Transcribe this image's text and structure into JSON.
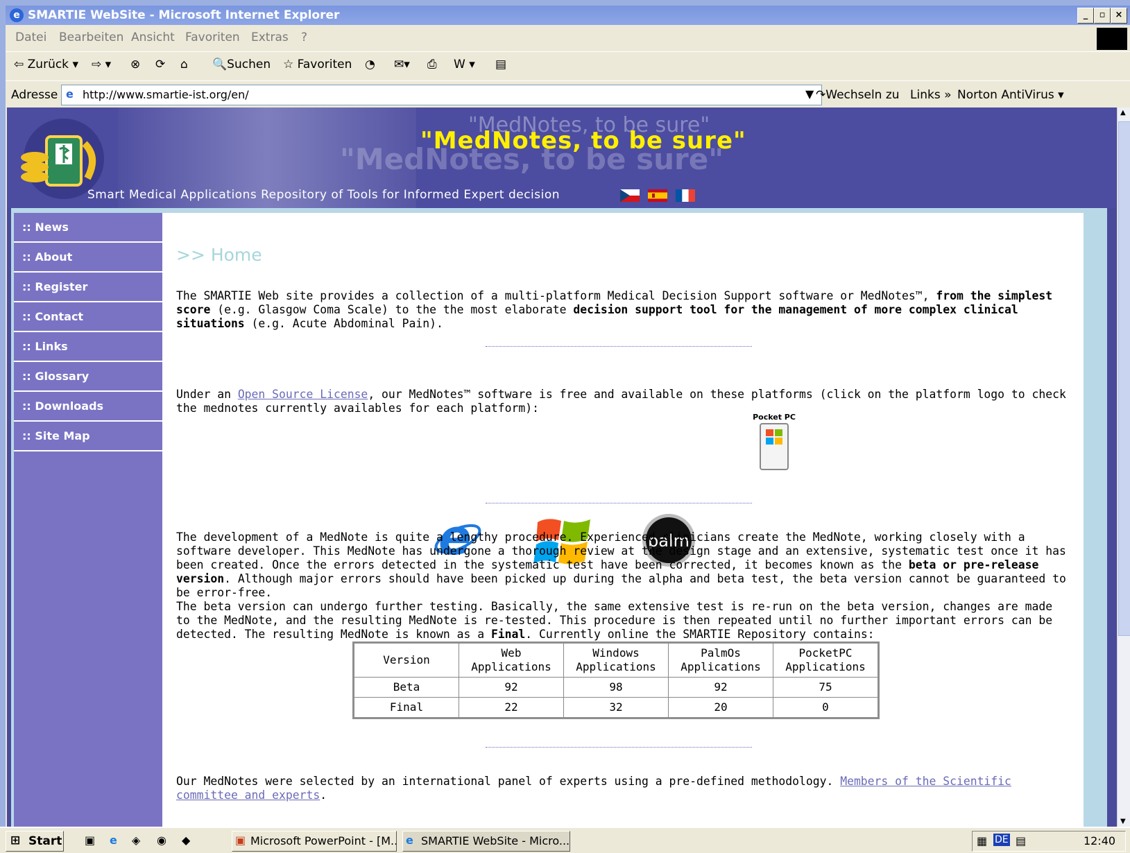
{
  "window": {
    "title": "SMARTIE WebSite - Microsoft Internet Explorer"
  },
  "menu": [
    "Datei",
    "Bearbeiten",
    "Ansicht",
    "Favoriten",
    "Extras",
    "?"
  ],
  "toolbar": {
    "back": "Zurück",
    "search": "Suchen",
    "favorites": "Favoriten"
  },
  "addressbar": {
    "label": "Adresse",
    "url": "http://www.smartie-ist.org/en/",
    "go": "Wechseln zu",
    "links": "Links",
    "norton": "Norton AntiVirus"
  },
  "banner": {
    "slogan": "\"MedNotes, to be sure\"",
    "tagline": "Smart Medical Applications Repository of Tools for Informed Expert decision"
  },
  "nav": [
    ":: News",
    ":: About",
    ":: Register",
    ":: Contact",
    ":: Links",
    ":: Glossary",
    ":: Downloads",
    ":: Site Map"
  ],
  "main": {
    "heading": ">> Home",
    "intro": {
      "p1": "The SMARTIE Web site provides a collection of a multi-platform Medical Decision Support software or MedNotes™, ",
      "b1": "from the simplest score",
      "p2": " (e.g. Glasgow Coma Scale) to the the most elaborate ",
      "b2": "decision support tool for the management of more complex clinical situations",
      "p3": " (e.g. Acute Abdominal Pain)."
    },
    "license": {
      "pre": "Under an ",
      "link": "Open Source License",
      "post": ", our MedNotes™ software is free and available on these platforms (click on the platform logo to check the mednotes currently availables for each platform):"
    },
    "platforms": [
      "ie-logo",
      "windows-logo",
      "palm-logo",
      "pocketpc-logo"
    ],
    "pocketpc_label": "Pocket PC",
    "palm_label": "palm",
    "development": {
      "p1": "The development of a MedNote is quite a lengthy procedure. Experienced clinicians create the MedNote, working closely with a software developer. This MedNote has undergone a thorough review at the design stage and an extensive, systematic test once it has been created. Once the errors detected in the systematic test have been corrected, it becomes known as the ",
      "b1": "beta or pre-release version",
      "p2": ". Although major errors should have been picked up during the alpha and beta test, the beta version cannot be guaranteed to be error-free.",
      "p3": "The beta version can undergo further testing. Basically, the same extensive test is re-run on the beta version, changes are made to the MedNote, and the resulting MedNote is re-tested. This procedure is then repeated until no further important errors can be detected. The resulting MedNote is known as a ",
      "b2": "Final",
      "p4": ". Currently online the SMARTIE Repository contains:"
    },
    "table": {
      "headers": [
        "Version",
        "Web Applications",
        "Windows Applications",
        "PalmOs Applications",
        "PocketPC Applications"
      ],
      "rows": [
        [
          "Beta",
          "92",
          "98",
          "92",
          "75"
        ],
        [
          "Final",
          "22",
          "32",
          "20",
          "0"
        ]
      ]
    },
    "panel": {
      "pre": "Our MedNotes were selected by an international panel of experts using a pre-defined methodology. ",
      "link": "Members of the Scientific committee and experts",
      "post": "."
    }
  },
  "taskbar": {
    "start": "Start",
    "tasks": [
      "Microsoft PowerPoint - [M...",
      "SMARTIE WebSite - Micro..."
    ],
    "lang": "DE",
    "clock": "12:40"
  },
  "colors": {
    "banner": "#4c4ca0",
    "nav": "#7a73c4",
    "slogan": "#fff000",
    "heading": "#a6d6dc",
    "link": "#6a6ab8"
  }
}
